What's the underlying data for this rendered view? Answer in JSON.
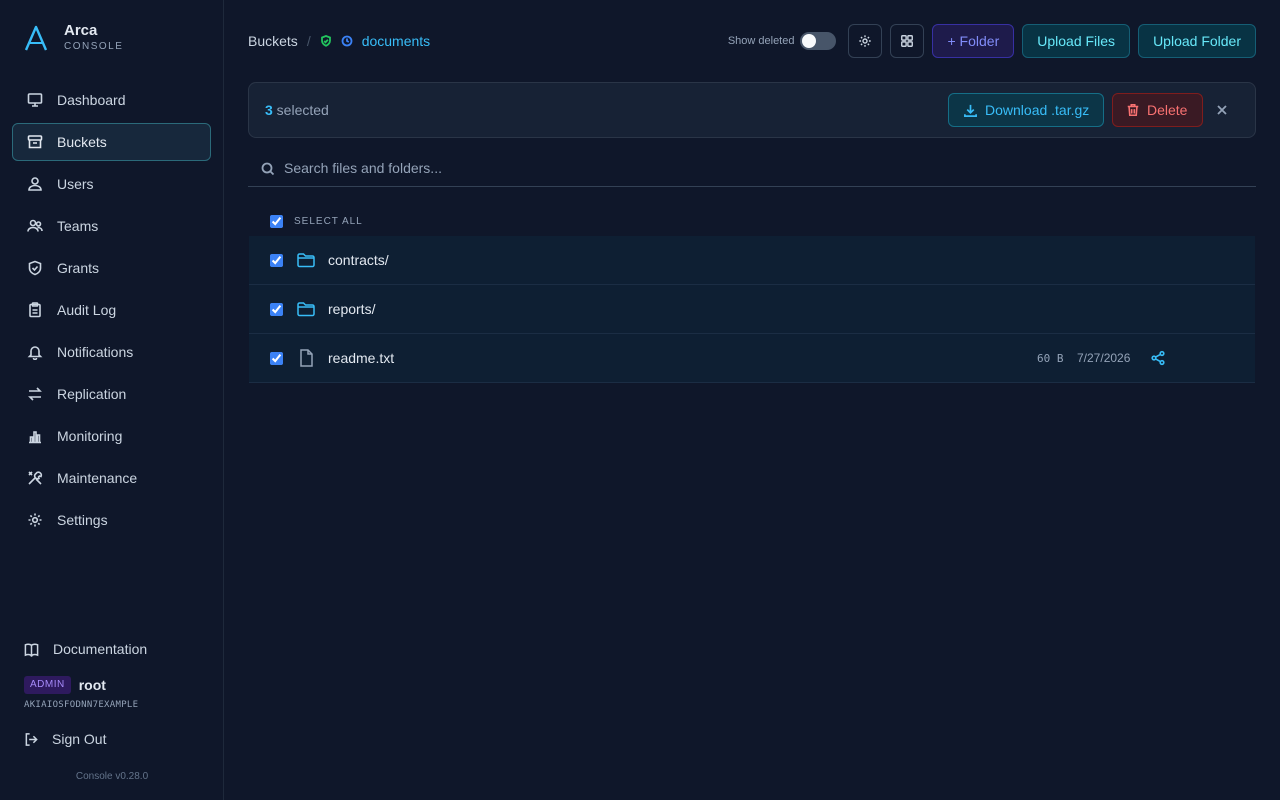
{
  "brand": {
    "name": "Arca",
    "subtitle": "CONSOLE"
  },
  "colors": {
    "accent": "#38bdf8",
    "danger": "#f87171",
    "folder_btn": "#818cf8",
    "background": "#0f172a"
  },
  "sidebar": {
    "items": [
      {
        "label": "Dashboard",
        "icon": "monitor-icon"
      },
      {
        "label": "Buckets",
        "icon": "archive-icon",
        "active": true
      },
      {
        "label": "Users",
        "icon": "user-icon"
      },
      {
        "label": "Teams",
        "icon": "users-icon"
      },
      {
        "label": "Grants",
        "icon": "shield-icon"
      },
      {
        "label": "Audit Log",
        "icon": "clipboard-icon"
      },
      {
        "label": "Notifications",
        "icon": "bell-icon"
      },
      {
        "label": "Replication",
        "icon": "arrows-icon"
      },
      {
        "label": "Monitoring",
        "icon": "bar-chart-icon"
      },
      {
        "label": "Maintenance",
        "icon": "tools-icon"
      },
      {
        "label": "Settings",
        "icon": "gear-icon"
      }
    ],
    "documentation": "Documentation",
    "user": {
      "role": "ADMIN",
      "name": "root",
      "access_key": "AKIAIOSFODNN7EXAMPLE"
    },
    "sign_out": "Sign Out",
    "version": "Console v0.28.0"
  },
  "breadcrumb": {
    "root": "Buckets",
    "separator": "/",
    "current": "documents"
  },
  "toolbar": {
    "show_deleted_label": "Show deleted",
    "show_deleted_on": false,
    "new_folder": "+ Folder",
    "upload_files": "Upload Files",
    "upload_folder": "Upload Folder"
  },
  "selection": {
    "count": "3",
    "suffix": " selected",
    "download": "Download .tar.gz",
    "delete": "Delete"
  },
  "search": {
    "placeholder": "Search files and folders..."
  },
  "list": {
    "select_all": "Select all",
    "items": [
      {
        "name": "contracts/",
        "type": "folder",
        "size": "",
        "date": ""
      },
      {
        "name": "reports/",
        "type": "folder",
        "size": "",
        "date": ""
      },
      {
        "name": "readme.txt",
        "type": "file",
        "size": "60 B",
        "date": "7/27/2026"
      }
    ]
  }
}
